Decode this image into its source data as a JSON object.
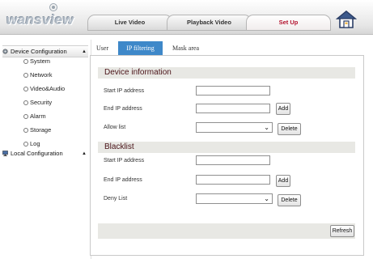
{
  "header": {
    "logo": "wansview",
    "tabs": [
      {
        "label": "Live Video"
      },
      {
        "label": "Playback Video"
      },
      {
        "label": "Set Up"
      }
    ]
  },
  "sidebar": {
    "groups": [
      {
        "label": "Device Configuration",
        "caret": "▲",
        "items": [
          {
            "label": "System"
          },
          {
            "label": "Network"
          },
          {
            "label": "Video&Audio"
          },
          {
            "label": "Security"
          },
          {
            "label": "Alarm"
          },
          {
            "label": "Storage"
          },
          {
            "label": "Log"
          }
        ]
      },
      {
        "label": "Local Configuration",
        "caret": "▲"
      }
    ]
  },
  "subtabs": [
    {
      "label": "User"
    },
    {
      "label": "IP filtering"
    },
    {
      "label": "Mask area"
    }
  ],
  "device_info": {
    "title": "Device information",
    "start_ip_label": "Start IP address",
    "start_ip_value": "",
    "end_ip_label": "End IP address",
    "end_ip_value": "",
    "add_label": "Add",
    "list_label": "Allow list",
    "list_value": "",
    "delete_label": "Delete"
  },
  "blacklist": {
    "title": "Blacklist",
    "start_ip_label": "Start IP address",
    "start_ip_value": "",
    "end_ip_label": "End IP address",
    "end_ip_value": "",
    "add_label": "Add",
    "list_label": "Deny List",
    "list_value": "",
    "delete_label": "Delete"
  },
  "refresh_label": "Refresh",
  "icons": {
    "home": "home-icon",
    "caret": "chevron-down-icon",
    "gear": "gear-icon",
    "monitor": "monitor-icon"
  },
  "colors": {
    "active_tab_text": "#b3132e",
    "subtab_active_bg": "#3e88c9",
    "section_title": "#4a1318",
    "section_bg": "#e8e8e4"
  }
}
